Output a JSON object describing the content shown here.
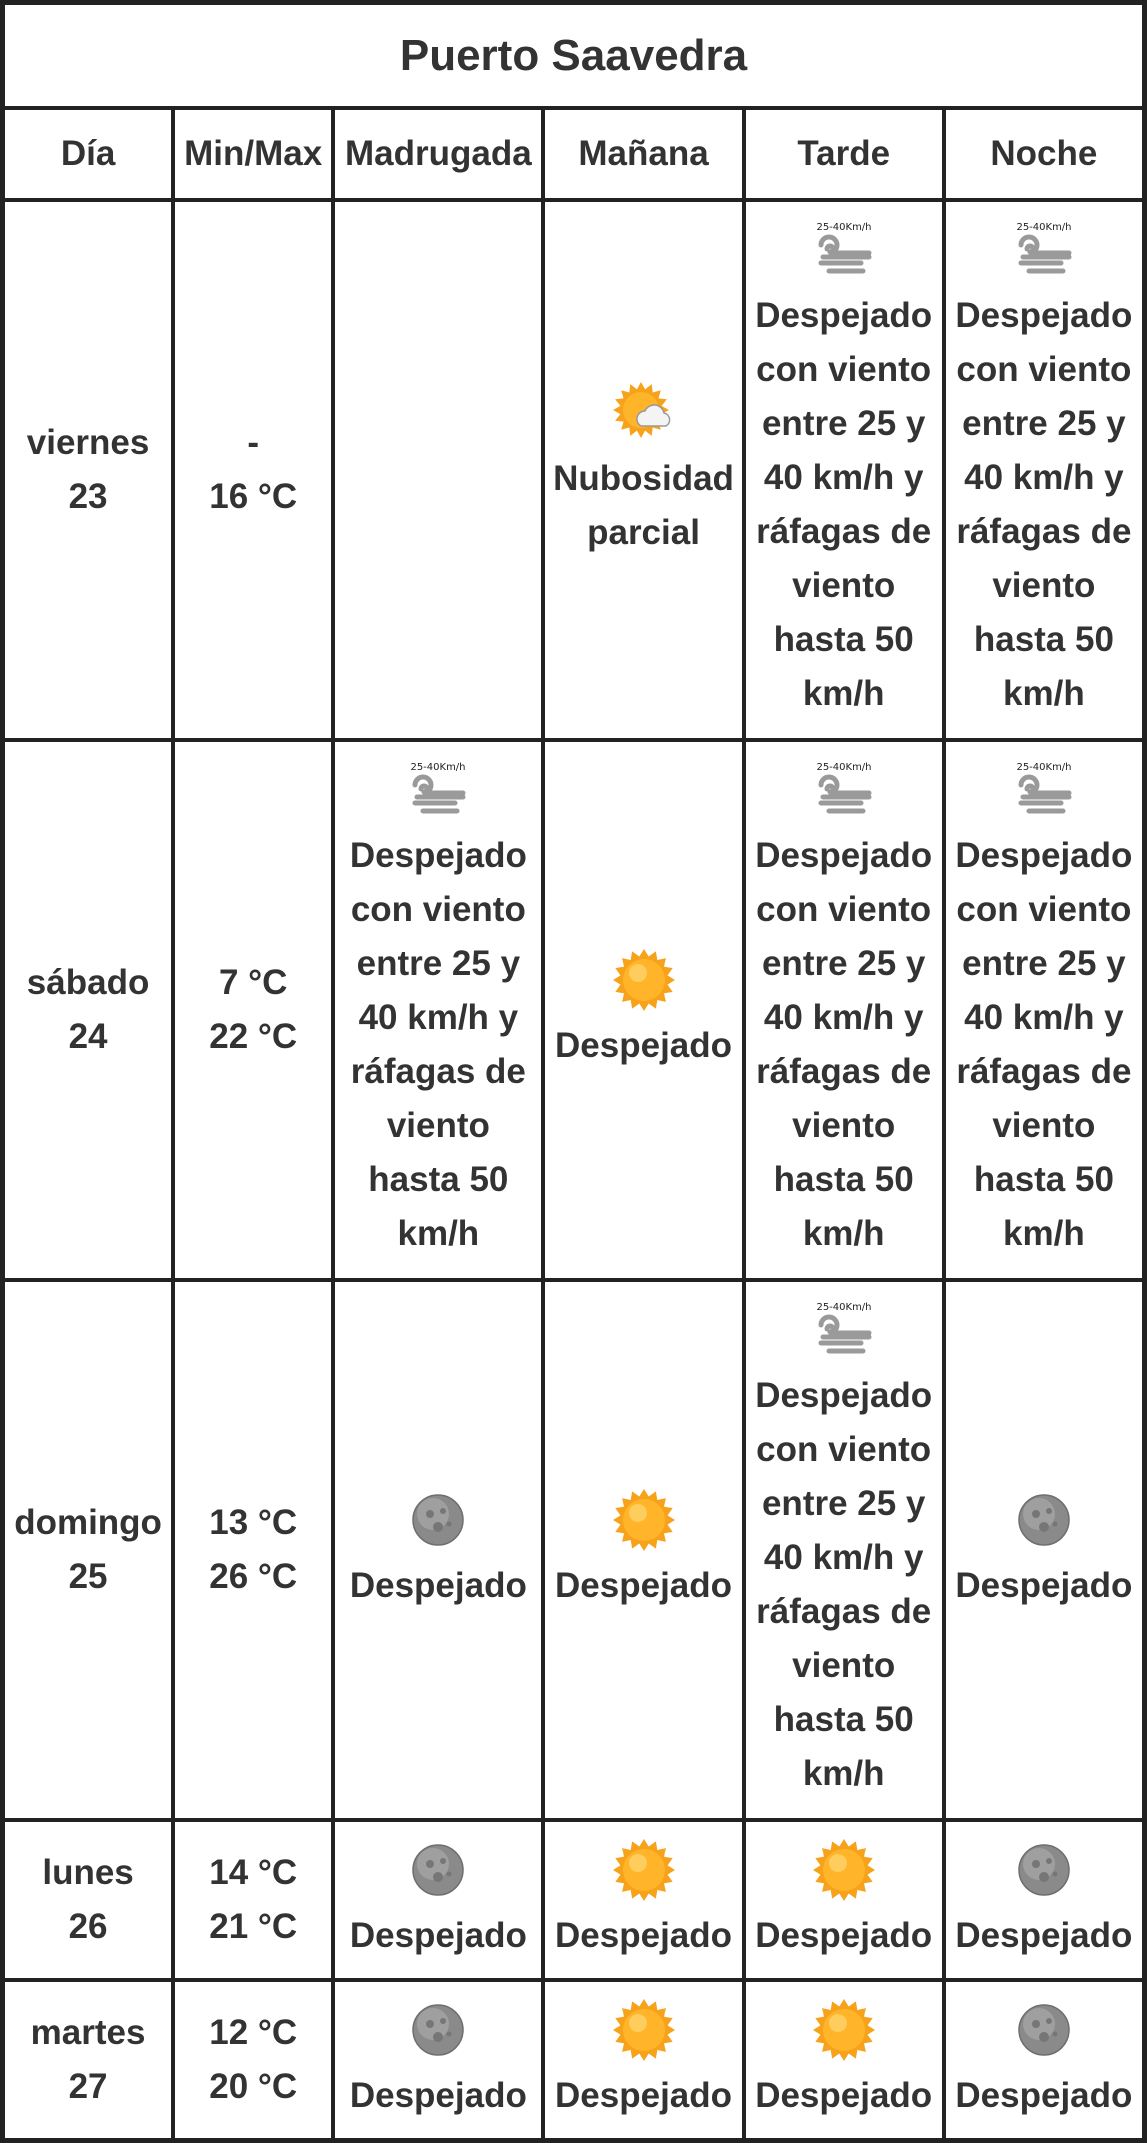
{
  "title": "Puerto Saavedra",
  "headers": {
    "day": "Día",
    "minmax": "Min/Max",
    "madrugada": "Madrugada",
    "manana": "Mañana",
    "tarde": "Tarde",
    "noche": "Noche"
  },
  "wind_badge": "25-40Km/h",
  "days": [
    {
      "name": "viernes",
      "num": "23",
      "min": "-",
      "max": "16 °C",
      "madrugada": {
        "icon": "",
        "text": ""
      },
      "manana": {
        "icon": "sun-cloud-icon",
        "text": "Nubosidad parcial"
      },
      "tarde": {
        "icon": "wind-icon",
        "text": "Despejado con viento entre 25 y 40 km/h y ráfagas de viento hasta 50 km/h"
      },
      "noche": {
        "icon": "wind-icon",
        "text": "Despejado con viento entre 25 y 40 km/h y ráfagas de viento hasta 50 km/h"
      }
    },
    {
      "name": "sábado",
      "num": "24",
      "min": "7 °C",
      "max": "22 °C",
      "madrugada": {
        "icon": "wind-icon",
        "text": "Despejado con viento entre 25 y 40 km/h y ráfagas de viento hasta 50 km/h"
      },
      "manana": {
        "icon": "sun-icon",
        "text": "Despejado"
      },
      "tarde": {
        "icon": "wind-icon",
        "text": "Despejado con viento entre 25 y 40 km/h y ráfagas de viento hasta 50 km/h"
      },
      "noche": {
        "icon": "wind-icon",
        "text": "Despejado con viento entre 25 y 40 km/h y ráfagas de viento hasta 50 km/h"
      }
    },
    {
      "name": "domingo",
      "num": "25",
      "min": "13 °C",
      "max": "26 °C",
      "madrugada": {
        "icon": "moon-icon",
        "text": "Despejado"
      },
      "manana": {
        "icon": "sun-icon",
        "text": "Despejado"
      },
      "tarde": {
        "icon": "wind-icon",
        "text": "Despejado con viento entre 25 y 40 km/h y ráfagas de viento hasta 50 km/h"
      },
      "noche": {
        "icon": "moon-icon",
        "text": "Despejado"
      }
    },
    {
      "name": "lunes",
      "num": "26",
      "min": "14 °C",
      "max": "21 °C",
      "madrugada": {
        "icon": "moon-icon",
        "text": "Despejado"
      },
      "manana": {
        "icon": "sun-icon",
        "text": "Despejado"
      },
      "tarde": {
        "icon": "sun-icon",
        "text": "Despejado"
      },
      "noche": {
        "icon": "moon-icon",
        "text": "Despejado"
      }
    },
    {
      "name": "martes",
      "num": "27",
      "min": "12 °C",
      "max": "20 °C",
      "madrugada": {
        "icon": "moon-icon",
        "text": "Despejado"
      },
      "manana": {
        "icon": "sun-icon",
        "text": "Despejado"
      },
      "tarde": {
        "icon": "sun-icon",
        "text": "Despejado"
      },
      "noche": {
        "icon": "moon-icon",
        "text": "Despejado"
      }
    }
  ],
  "colors": {
    "border": "#222222",
    "text": "#333333",
    "sun": "#f7a21b",
    "moon": "#8a8a8a",
    "wind": "#9a9a9a"
  }
}
